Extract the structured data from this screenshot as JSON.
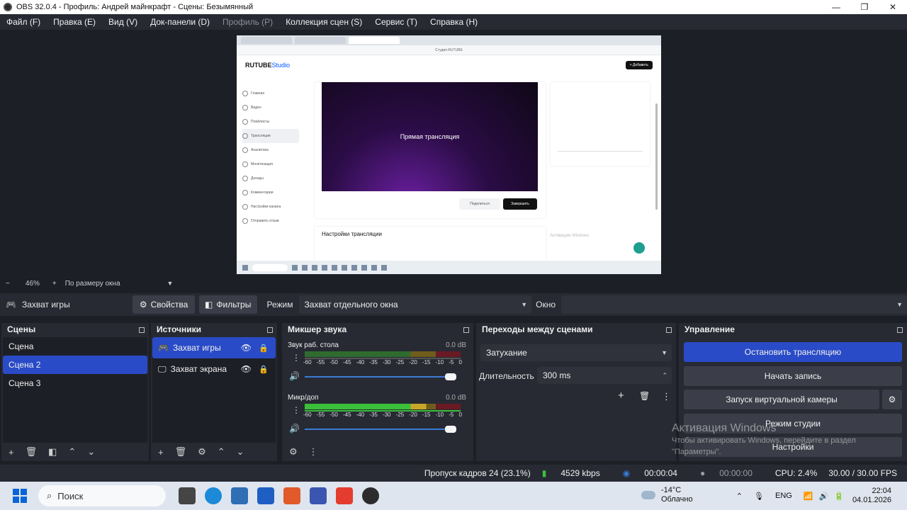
{
  "window": {
    "title": "OBS 32.0.4 - Профиль: Андрей майнкрафт - Сцены: Безымянный",
    "controls": [
      "—",
      "❐",
      "✕"
    ]
  },
  "menu": [
    {
      "label": "Файл (F)",
      "disabled": false
    },
    {
      "label": "Правка (E)",
      "disabled": false
    },
    {
      "label": "Вид (V)",
      "disabled": false
    },
    {
      "label": "Док-панели (D)",
      "disabled": false
    },
    {
      "label": "Профиль (P)",
      "disabled": true
    },
    {
      "label": "Коллекция сцен (S)",
      "disabled": false
    },
    {
      "label": "Сервис (T)",
      "disabled": false
    },
    {
      "label": "Справка (H)",
      "disabled": false
    }
  ],
  "preview": {
    "address": "Студия RUTUBE",
    "logo_main": "RUTUBE",
    "logo_sub": "Studio",
    "add_button": "+ Добавить",
    "video_label": "Прямая трансляция",
    "share_button": "Поделиться",
    "finish_button": "Завершить",
    "settings_title": "Настройки трансляции",
    "watermark": "Активация Windows",
    "sidebar": [
      "Главная",
      "Видео",
      "Плейлисты",
      "Трансляции",
      "Аналитика",
      "Монетизация",
      "Доходы",
      "Комментарии",
      "Настройки канала",
      "Отправить отзыв"
    ]
  },
  "zoom": {
    "value": "46%",
    "mode": "По размеру окна"
  },
  "source_toolbar": {
    "source_name": "Захват игры",
    "properties": "Свойства",
    "filters": "Фильтры",
    "mode_label": "Режим",
    "mode_value": "Захват отдельного окна",
    "window_label": "Окно",
    "window_value": ""
  },
  "scenes": {
    "title": "Сцены",
    "items": [
      "Сцена",
      "Сцена 2",
      "Сцена 3"
    ],
    "selected": "Сцена 2"
  },
  "sources": {
    "title": "Источники",
    "items": [
      {
        "name": "Захват игры",
        "icon": "gamepad-icon"
      },
      {
        "name": "Захват экрана",
        "icon": "monitor-icon"
      }
    ]
  },
  "mixer": {
    "title": "Микшер звука",
    "scale": [
      "-60",
      "-55",
      "-50",
      "-45",
      "-40",
      "-35",
      "-30",
      "-25",
      "-20",
      "-15",
      "-10",
      "-5",
      "0"
    ],
    "channels": [
      {
        "name": "Звук раб. стола",
        "db": "0.0 dB",
        "volume_fraction": 1.0
      },
      {
        "name": "Микр/доп",
        "db": "0.0 dB",
        "volume_fraction": 1.0
      }
    ]
  },
  "transitions": {
    "title": "Переходы между сценами",
    "type": "Затухание",
    "duration_label": "Длительность",
    "duration_value": "300 ms"
  },
  "controls": {
    "title": "Управление",
    "stop_stream": "Остановить трансляцию",
    "start_record": "Начать запись",
    "virtual_cam": "Запуск виртуальной камеры",
    "studio_mode": "Режим студии",
    "settings": "Настройки"
  },
  "activation": {
    "title": "Активация Windows",
    "text": "Чтобы активировать Windows, перейдите в раздел \"Параметры\"."
  },
  "status": {
    "dropped": "Пропуск кадров 24 (23.1%)",
    "bitrate": "4529 kbps",
    "stream_time": "00:00:04",
    "record_time": "00:00:00",
    "cpu": "CPU: 2.4%",
    "fps": "30.00 / 30.00 FPS"
  },
  "taskbar": {
    "search": "Поиск",
    "temperature": "-14°C",
    "weather": "Облачно",
    "lang": "ENG",
    "time": "22:04",
    "date": "04.01.2026"
  },
  "colors": {
    "accent": "#2a4bc7",
    "panel": "#272a33",
    "background": "#1d1f26"
  }
}
